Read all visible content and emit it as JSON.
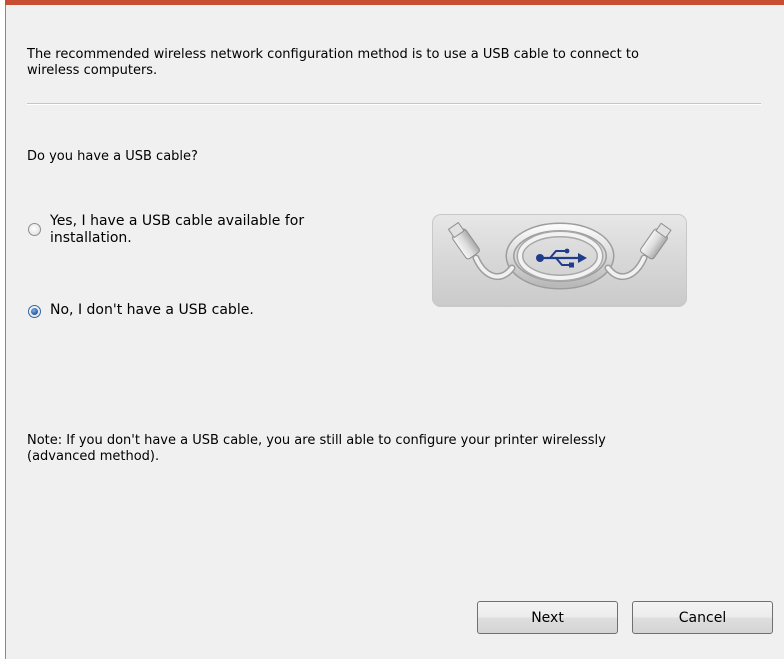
{
  "dialog": {
    "intro_line1": "The recommended wireless network configuration method is to use a USB cable to connect to",
    "intro_line2": "wireless computers.",
    "question": "Do you have a USB cable?",
    "options": [
      {
        "label_line1": "Yes, I have a USB cable available for",
        "label_line2": "installation.",
        "selected": false
      },
      {
        "label_line1": "No, I don't have a USB cable.",
        "selected": true
      }
    ],
    "note_line1": "Note:  If you don't have a USB cable, you are still able to configure your printer wirelessly",
    "note_line2": "(advanced method).",
    "illustration_icon": "usb-cable-icon"
  },
  "buttons": {
    "next": "Next",
    "cancel": "Cancel"
  },
  "colors": {
    "background": "#f0f0f0",
    "accent": "#c94d32",
    "radio_selected": "#2a63a6"
  }
}
